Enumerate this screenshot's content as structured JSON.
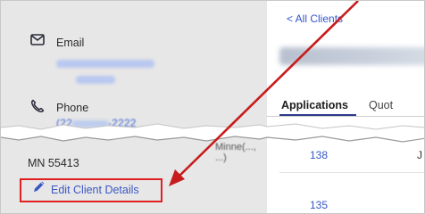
{
  "contact": {
    "email_label": "Email",
    "phone_label": "Phone",
    "phone_value": "(22",
    "phone_value_tail": "-2222",
    "address_partial": "Minne(..., ...)",
    "address_zip": "MN 55413",
    "edit_label": "Edit Client Details"
  },
  "nav": {
    "back_label": "< All Clients"
  },
  "tabs": [
    {
      "label": "Applications",
      "active": true
    },
    {
      "label": "Quot",
      "active": false
    }
  ],
  "rows": [
    {
      "id": "138"
    },
    {
      "id": "135"
    }
  ],
  "cut_glyph": "J",
  "colors": {
    "link": "#3b57c4",
    "highlight": "#e02020",
    "panel": "#e7e7e7"
  },
  "icons": [
    "envelope-icon",
    "phone-icon",
    "pencil-icon",
    "back-chevron-icon"
  ]
}
